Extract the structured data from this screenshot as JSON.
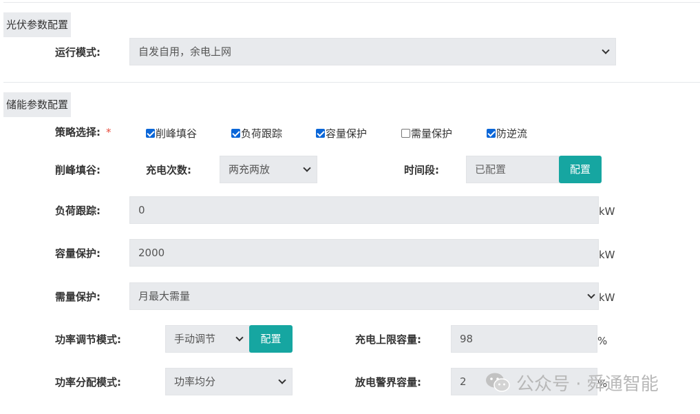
{
  "pv": {
    "section_title": "光伏参数配置",
    "run_mode_label": "运行模式:",
    "run_mode_value": "自发自用，余电上网"
  },
  "ess": {
    "section_title": "储能参数配置",
    "strategy_label": "策略选择:",
    "required_mark": "*",
    "strategies": [
      {
        "label": "削峰填谷",
        "checked": true
      },
      {
        "label": "负荷跟踪",
        "checked": true
      },
      {
        "label": "容量保护",
        "checked": true
      },
      {
        "label": "需量保护",
        "checked": false
      },
      {
        "label": "防逆流",
        "checked": true
      }
    ],
    "peak_label": "削峰填谷:",
    "charge_times_label": "充电次数:",
    "charge_times_value": "两充两放",
    "time_period_label": "时间段:",
    "time_period_value": "已配置",
    "config_button": "配置",
    "load_tracking_label": "负荷跟踪:",
    "load_tracking_value": "0",
    "load_tracking_unit": "kW",
    "capacity_label": "容量保护:",
    "capacity_value": "2000",
    "capacity_unit": "kW",
    "demand_label": "需量保护:",
    "demand_value": "月最大需量",
    "demand_unit": "kW",
    "power_adjust_label": "功率调节模式:",
    "power_adjust_value": "手动调节",
    "power_adjust_button": "配置",
    "charge_limit_label": "充电上限容量:",
    "charge_limit_value": "98",
    "charge_limit_unit": "%",
    "power_dist_label": "功率分配模式:",
    "power_dist_value": "功率均分",
    "discharge_alarm_label": "放电警界容量:",
    "discharge_alarm_value": "2",
    "discharge_alarm_unit": "%"
  },
  "watermark": {
    "text": "公众号 · 舜通智能",
    "icon": "wechat-icon"
  },
  "colors": {
    "accent": "#16a6a1",
    "field_bg": "#e8eaed",
    "checkbox": "#0a66d8",
    "required": "#e74c3c"
  }
}
